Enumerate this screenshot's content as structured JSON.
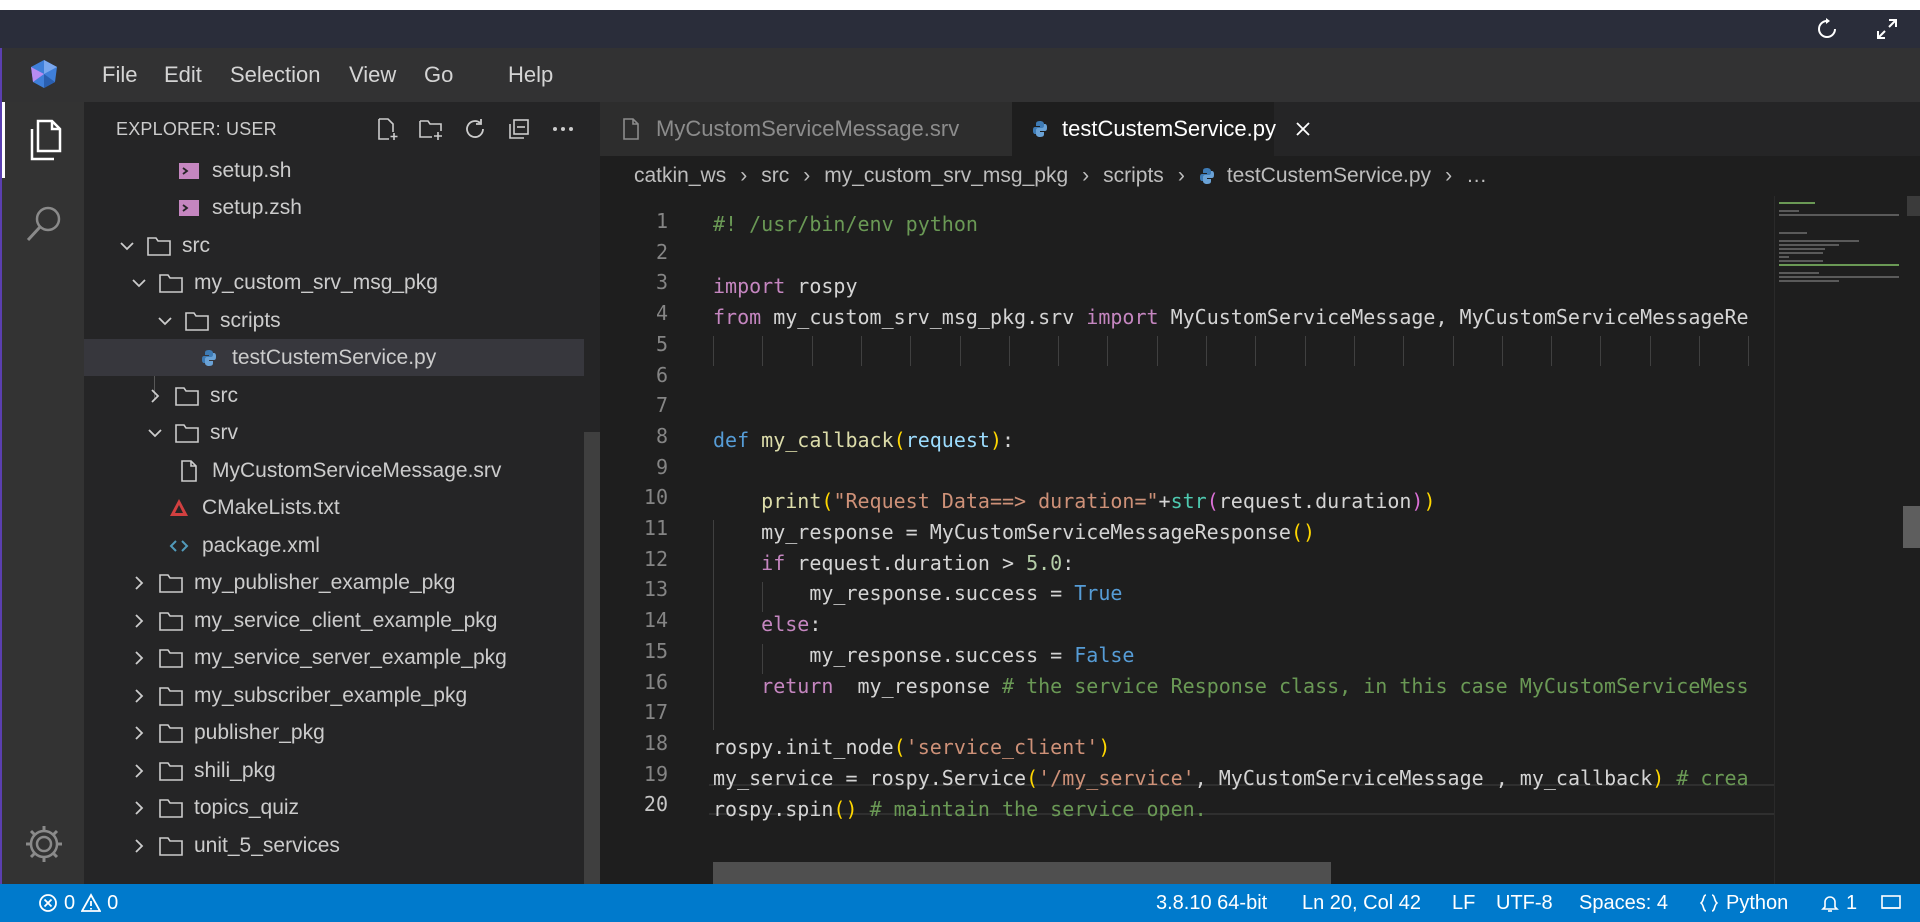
{
  "window": {
    "menu": [
      "File",
      "Edit",
      "Selection",
      "View",
      "Go",
      "Help"
    ],
    "accent_color": "#5b3fb0"
  },
  "activity": {
    "items": [
      "explorer-icon",
      "search-icon"
    ],
    "bottom": "gear-icon"
  },
  "explorer": {
    "title": "EXPLORER: USER",
    "actions": [
      "new-file-icon",
      "new-folder-icon",
      "refresh-icon",
      "collapse-all-icon",
      "more-icon"
    ],
    "tree": [
      {
        "label": "setup.sh",
        "kind": "shell",
        "expanded": null
      },
      {
        "label": "setup.zsh",
        "kind": "shell",
        "expanded": null
      },
      {
        "label": "src",
        "kind": "folder",
        "expanded": true
      },
      {
        "label": "my_custom_srv_msg_pkg",
        "kind": "folder",
        "expanded": true
      },
      {
        "label": "scripts",
        "kind": "folder",
        "expanded": true
      },
      {
        "label": "testCustemService.py",
        "kind": "python",
        "expanded": null,
        "selected": true
      },
      {
        "label": "src",
        "kind": "folder",
        "expanded": false
      },
      {
        "label": "srv",
        "kind": "folder",
        "expanded": true
      },
      {
        "label": "MyCustomServiceMessage.srv",
        "kind": "file",
        "expanded": null
      },
      {
        "label": "CMakeLists.txt",
        "kind": "cmake",
        "expanded": null
      },
      {
        "label": "package.xml",
        "kind": "xml",
        "expanded": null
      },
      {
        "label": "my_publisher_example_pkg",
        "kind": "folder",
        "expanded": false
      },
      {
        "label": "my_service_client_example_pkg",
        "kind": "folder",
        "expanded": false
      },
      {
        "label": "my_service_server_example_pkg",
        "kind": "folder",
        "expanded": false
      },
      {
        "label": "my_subscriber_example_pkg",
        "kind": "folder",
        "expanded": false
      },
      {
        "label": "publisher_pkg",
        "kind": "folder",
        "expanded": false
      },
      {
        "label": "shili_pkg",
        "kind": "folder",
        "expanded": false
      },
      {
        "label": "topics_quiz",
        "kind": "folder",
        "expanded": false
      },
      {
        "label": "unit_5_services",
        "kind": "folder",
        "expanded": false
      }
    ]
  },
  "tabs": [
    {
      "label": "MyCustomServiceMessage.srv",
      "active": false
    },
    {
      "label": "testCustemService.py",
      "active": true
    }
  ],
  "breadcrumbs": [
    "catkin_ws",
    "src",
    "my_custom_srv_msg_pkg",
    "scripts",
    "testCustemService.py",
    "…"
  ],
  "editor": {
    "current_line": 20,
    "line_numbers": [
      "1",
      "2",
      "3",
      "4",
      "5",
      "6",
      "7",
      "8",
      "9",
      "10",
      "11",
      "12",
      "13",
      "14",
      "15",
      "16",
      "17",
      "18",
      "19",
      "20"
    ]
  },
  "status": {
    "errors": "0",
    "warnings": "0",
    "interpreter": "3.8.10 64-bit",
    "position": "Ln 20, Col 42",
    "eol": "LF",
    "encoding": "UTF-8",
    "indent": "Spaces: 4",
    "language": "Python",
    "notifications": "1",
    "color": "#007acc"
  }
}
